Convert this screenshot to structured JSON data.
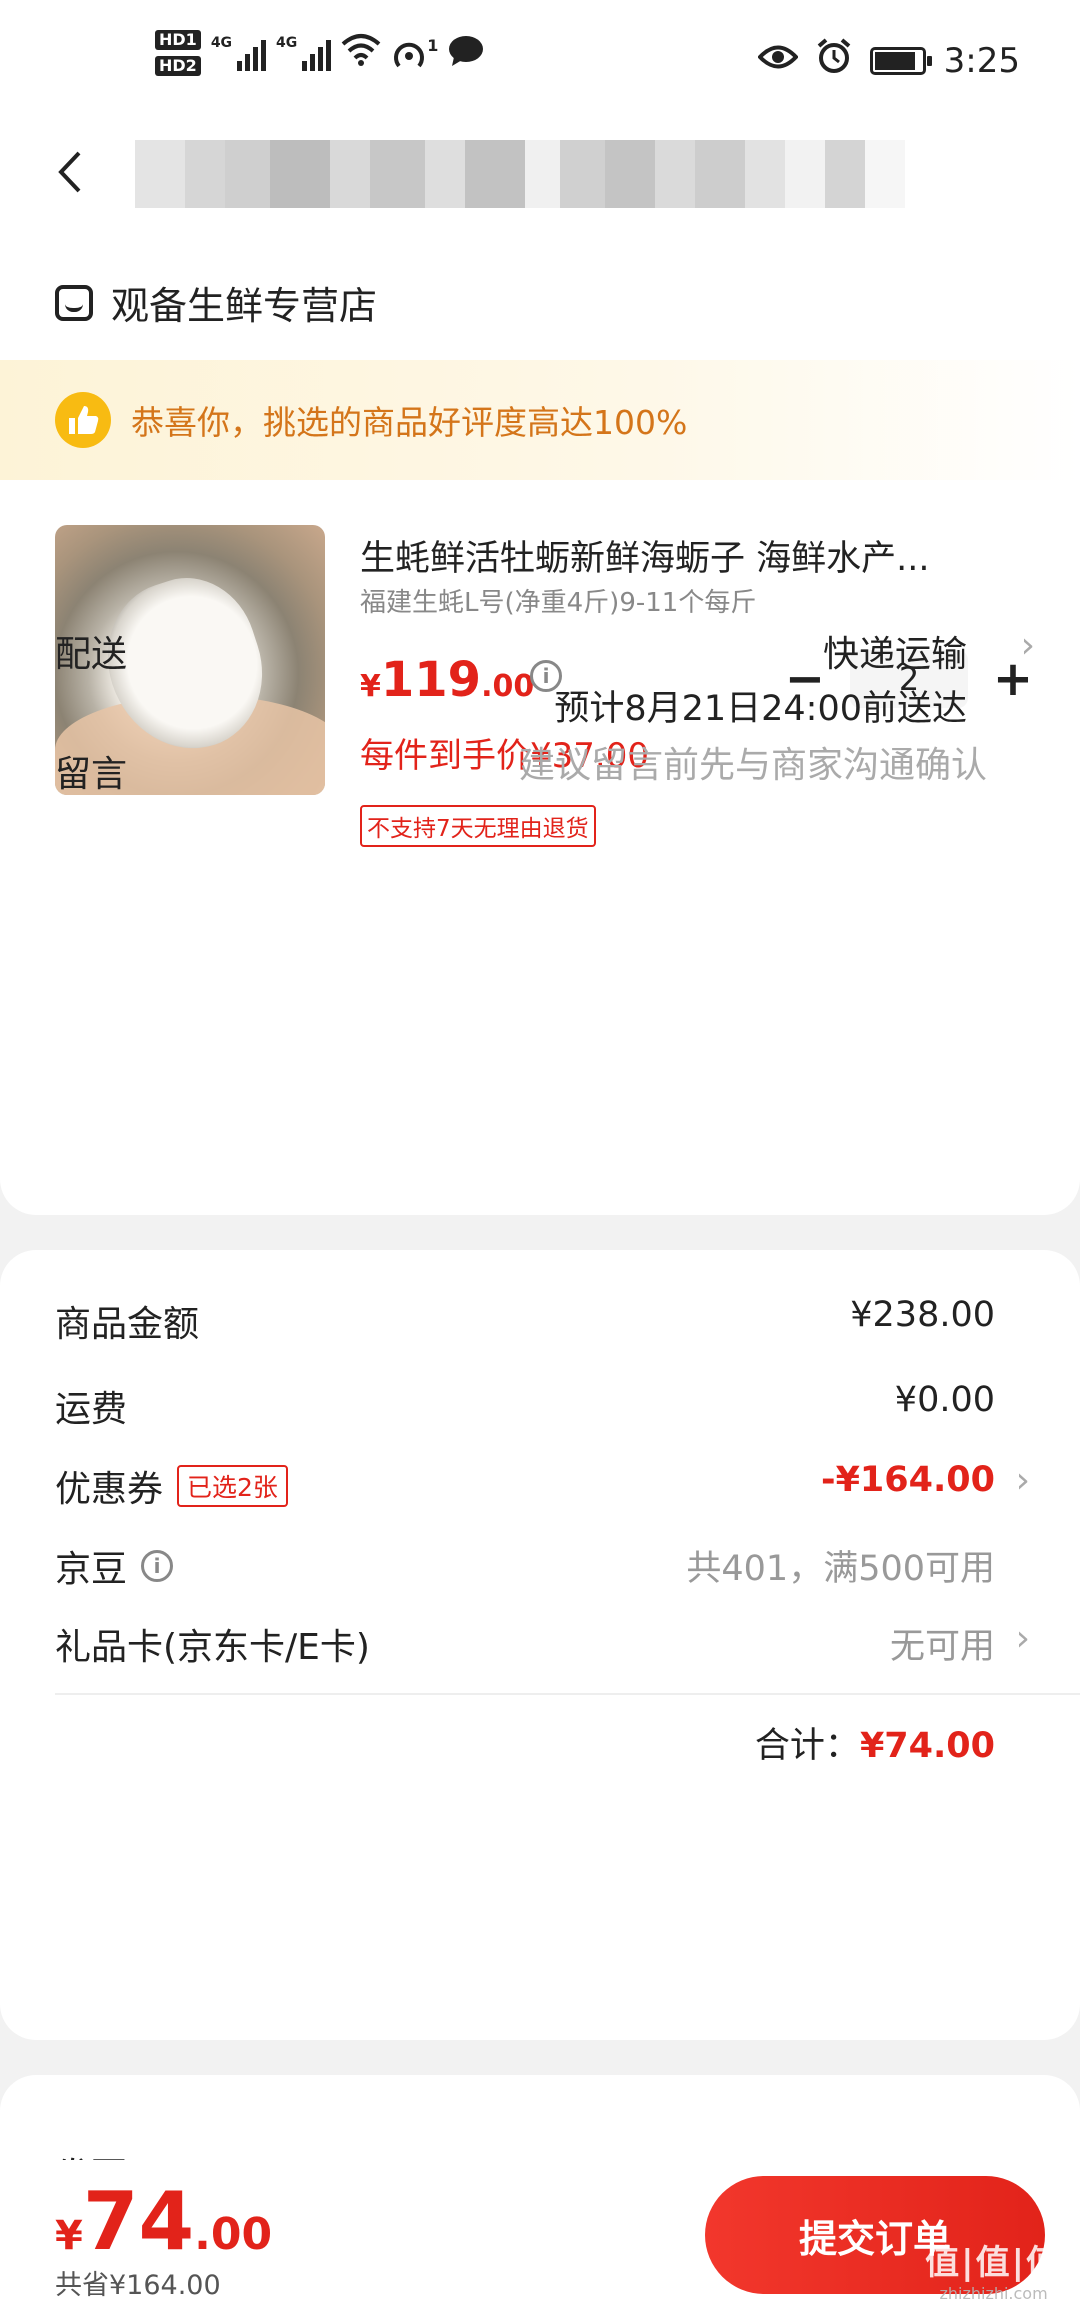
{
  "status_bar": {
    "hd1": "HD1",
    "hd2": "HD2",
    "net1": "4G",
    "net2": "4G",
    "hotspot_count": "1",
    "time": "3:25"
  },
  "store": {
    "name": "观备生鲜专营店"
  },
  "banner": {
    "text": "恭喜你，挑选的商品好评度高达100%"
  },
  "product": {
    "title": "生蚝鲜活牡蛎新鲜海蛎子 海鲜水产...",
    "spec": "福建生蚝L号(净重4斤)9-11个每斤",
    "price_currency": "¥",
    "price_int": "119",
    "price_dec": ".00",
    "final_price": "每件到手价¥37.00",
    "return_tag": "不支持7天无理由退货",
    "quantity": "2",
    "minus": "−",
    "plus": "+"
  },
  "shipping": {
    "label": "配送",
    "method": "快递运输",
    "eta": "预计8月21日24:00前送达"
  },
  "message": {
    "label": "留言",
    "placeholder": "建议留言前先与商家沟通确认"
  },
  "summary": {
    "goods_label": "商品金额",
    "goods_value": "¥238.00",
    "freight_label": "运费",
    "freight_value": "¥0.00",
    "coupon_label": "优惠券",
    "coupon_tag": "已选2张",
    "coupon_value": "-¥164.00",
    "jingdou_label": "京豆",
    "jingdou_value": "共401，满500可用",
    "giftcard_label": "礼品卡(京东卡/E卡)",
    "giftcard_value": "无可用",
    "total_label": "合计：",
    "total_value": "¥74.00"
  },
  "invoice_peek": {
    "label": "发票"
  },
  "bottom_bar": {
    "currency": "¥",
    "price_int": "74",
    "price_dec": ".00",
    "saved": "共省¥164.00",
    "submit_label": "提交订单"
  },
  "watermark": {
    "logo": "值|值|值",
    "url": "zhizhizhi.com"
  },
  "colors": {
    "accent_red": "#e2231a",
    "banner_orange": "#d4751a",
    "badge_yellow": "#f8bb12"
  }
}
